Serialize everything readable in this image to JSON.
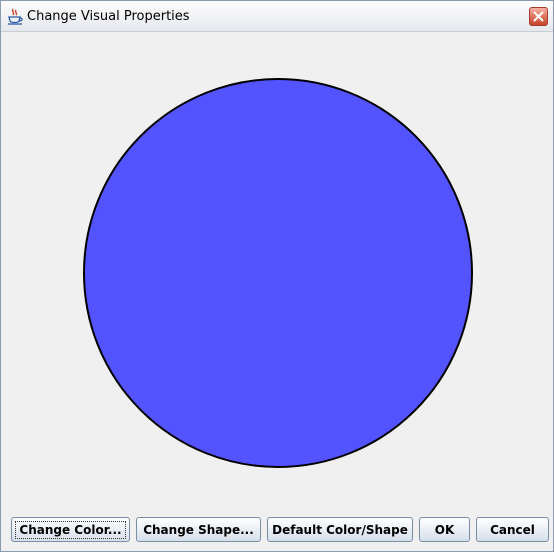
{
  "window": {
    "title": "Change Visual Properties",
    "icon": "java-coffee-cup-icon",
    "close_icon": "close-icon"
  },
  "shape": {
    "type": "circle",
    "fill_color": "#5353ff",
    "stroke_color": "#000000"
  },
  "buttons": {
    "change_color": "Change Color...",
    "change_shape": "Change Shape...",
    "default": "Default Color/Shape",
    "ok": "OK",
    "cancel": "Cancel"
  }
}
